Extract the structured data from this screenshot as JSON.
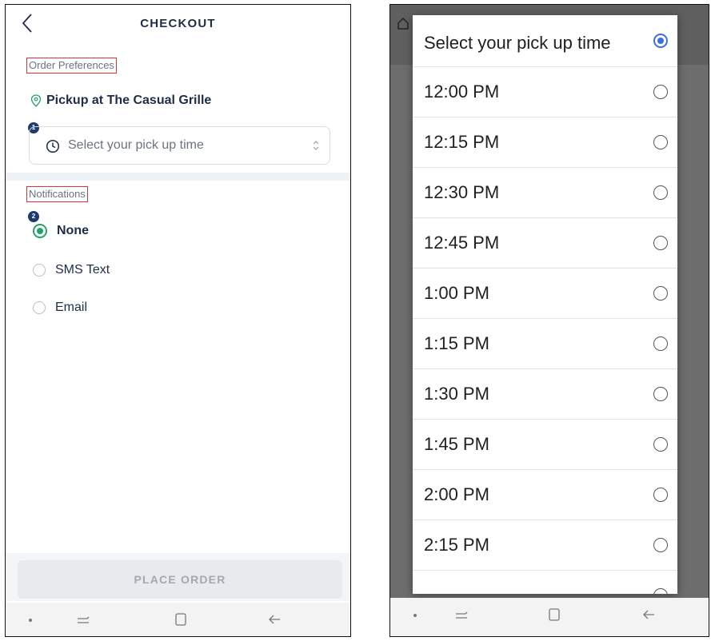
{
  "checkout": {
    "title": "CHECKOUT",
    "order_preferences_label": "Order Preferences",
    "pickup_location": "Pickup at The Casual Grille",
    "select_time_placeholder": "Select your pick up time",
    "badge_1": "1",
    "badge_2": "2",
    "notifications_label": "Notifications",
    "notification_options": [
      {
        "label": "None",
        "selected": true
      },
      {
        "label": "SMS Text",
        "selected": false
      },
      {
        "label": "Email",
        "selected": false
      }
    ],
    "place_order_label": "PLACE ORDER"
  },
  "picker": {
    "title": "Select your pick up time",
    "options": [
      "12:00 PM",
      "12:15 PM",
      "12:30 PM",
      "12:45 PM",
      "1:00 PM",
      "1:15 PM",
      "1:30 PM",
      "1:45 PM",
      "2:00 PM",
      "2:15 PM"
    ]
  },
  "colors": {
    "accent_green": "#22a36a",
    "navy": "#1f2d44",
    "picker_accent": "#3d6fe0",
    "annotation_red": "#dd3333"
  },
  "icons": [
    "chevron-left-icon",
    "map-pin-icon",
    "clock-icon",
    "updown-chevron-icon",
    "radio-icon",
    "nav-dot-icon",
    "recent-apps-icon",
    "home-square-icon",
    "back-arrow-icon"
  ]
}
